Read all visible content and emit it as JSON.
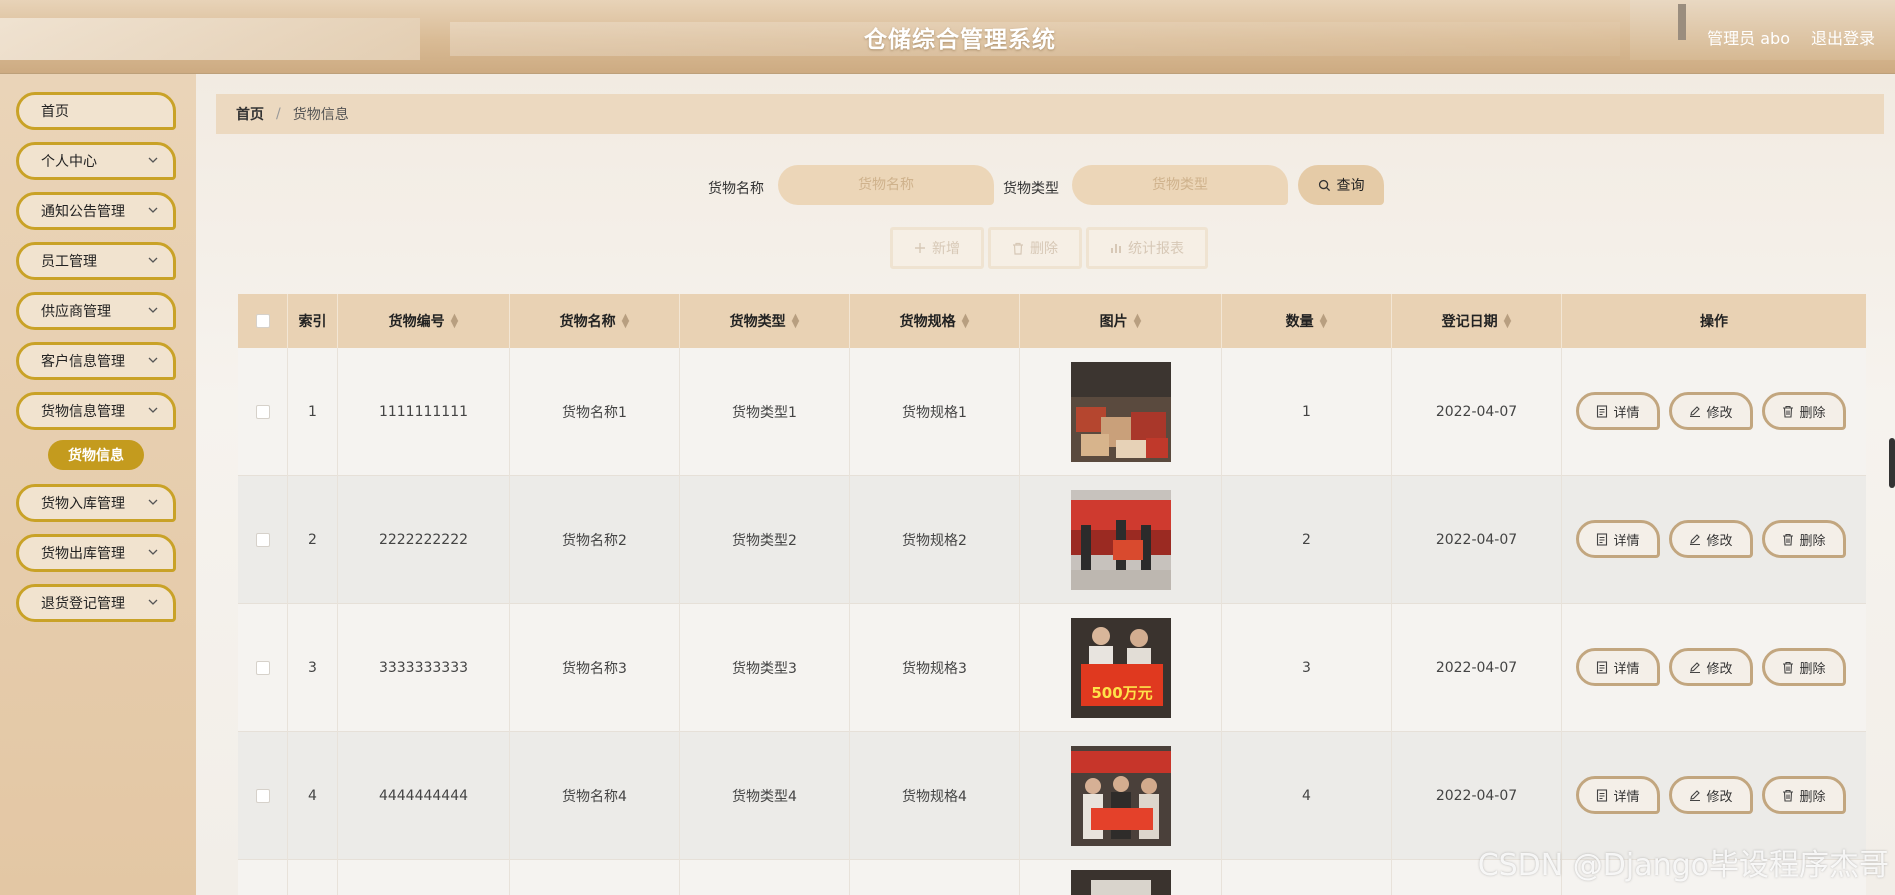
{
  "header": {
    "title": "仓储综合管理系统",
    "user": "管理员 abo",
    "logout": "退出登录"
  },
  "sidebar": {
    "items": [
      {
        "label": "首页",
        "expandable": false
      },
      {
        "label": "个人中心",
        "expandable": true
      },
      {
        "label": "通知公告管理",
        "expandable": true
      },
      {
        "label": "员工管理",
        "expandable": true
      },
      {
        "label": "供应商管理",
        "expandable": true
      },
      {
        "label": "客户信息管理",
        "expandable": true
      },
      {
        "label": "货物信息管理",
        "expandable": true
      },
      {
        "label": "货物入库管理",
        "expandable": true
      },
      {
        "label": "货物出库管理",
        "expandable": true
      },
      {
        "label": "退货登记管理",
        "expandable": true
      }
    ],
    "active_sub": "货物信息"
  },
  "breadcrumb": {
    "home": "首页",
    "separator": "/",
    "current": "货物信息"
  },
  "search": {
    "name_label": "货物名称",
    "name_placeholder": "货物名称",
    "type_label": "货物类型",
    "type_placeholder": "货物类型",
    "query_button": "查询"
  },
  "actions": {
    "add": "新增",
    "delete": "删除",
    "stats": "统计报表"
  },
  "table": {
    "headers": [
      "索引",
      "货物编号",
      "货物名称",
      "货物类型",
      "货物规格",
      "图片",
      "数量",
      "登记日期",
      "操作"
    ],
    "rows": [
      {
        "index": "1",
        "code": "1111111111",
        "name": "货物名称1",
        "type": "货物类型1",
        "spec": "货物规格1",
        "qty": "1",
        "date": "2022-04-07"
      },
      {
        "index": "2",
        "code": "2222222222",
        "name": "货物名称2",
        "type": "货物类型2",
        "spec": "货物规格2",
        "qty": "2",
        "date": "2022-04-07"
      },
      {
        "index": "3",
        "code": "3333333333",
        "name": "货物名称3",
        "type": "货物类型3",
        "spec": "货物规格3",
        "qty": "3",
        "date": "2022-04-07"
      },
      {
        "index": "4",
        "code": "4444444444",
        "name": "货物名称4",
        "type": "货物类型4",
        "spec": "货物规格4",
        "qty": "4",
        "date": "2022-04-07"
      }
    ],
    "row_actions": {
      "detail": "详情",
      "edit": "修改",
      "delete": "删除"
    }
  },
  "thumb_texts": {
    "banner3": "500万元"
  },
  "watermark": "CSDN @Django毕设程序杰哥",
  "colors": {
    "accent": "#c9a227",
    "header": "#d9bb95",
    "sidebar": "#e3c7a4",
    "table_header": "#e9d2b4"
  }
}
